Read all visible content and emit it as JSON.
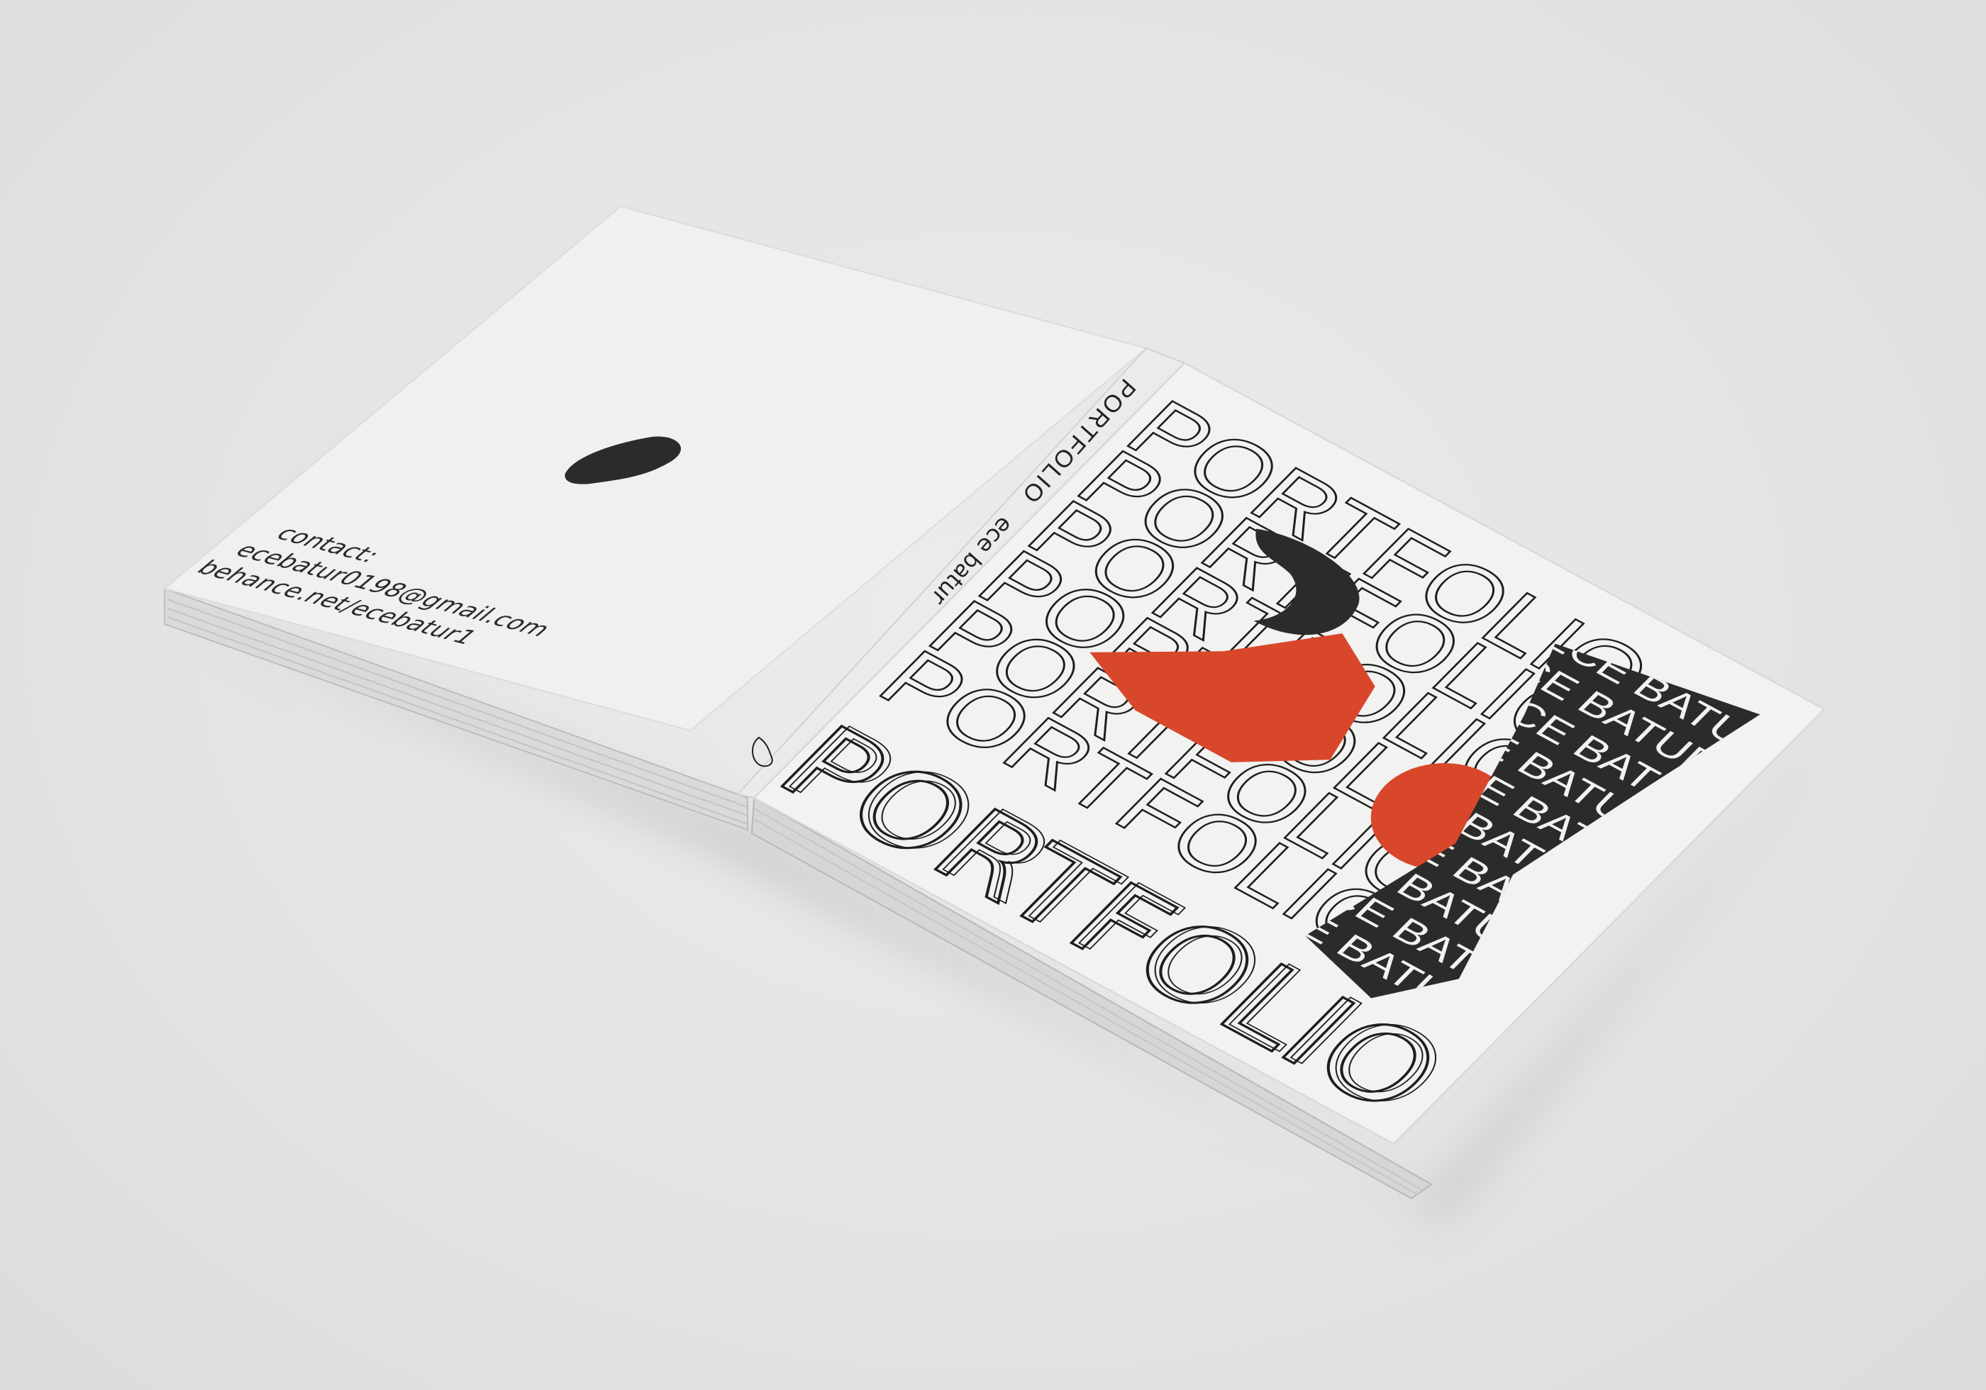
{
  "scene": "open hardcover portfolio book mockup",
  "colors": {
    "background": "#e4e4e4",
    "paper": "#f1f1f0",
    "ink": "#2a2a2a",
    "accent_orange": "#d9472b"
  },
  "back_cover": {
    "contact_label": "contact:",
    "email": "ecebatur0198@gmail.com",
    "website": "behance.net/ecebatur1",
    "blob_icon": "black-blob-shape"
  },
  "spine": {
    "title": "PORTFOLIO",
    "author": "ece batur",
    "logo_icon": "blob-outline"
  },
  "front_cover": {
    "repeated_title": "PORTFOLIO",
    "outline_title": "PORTFOLIO",
    "pattern_text": "ECE BATUR"
  }
}
